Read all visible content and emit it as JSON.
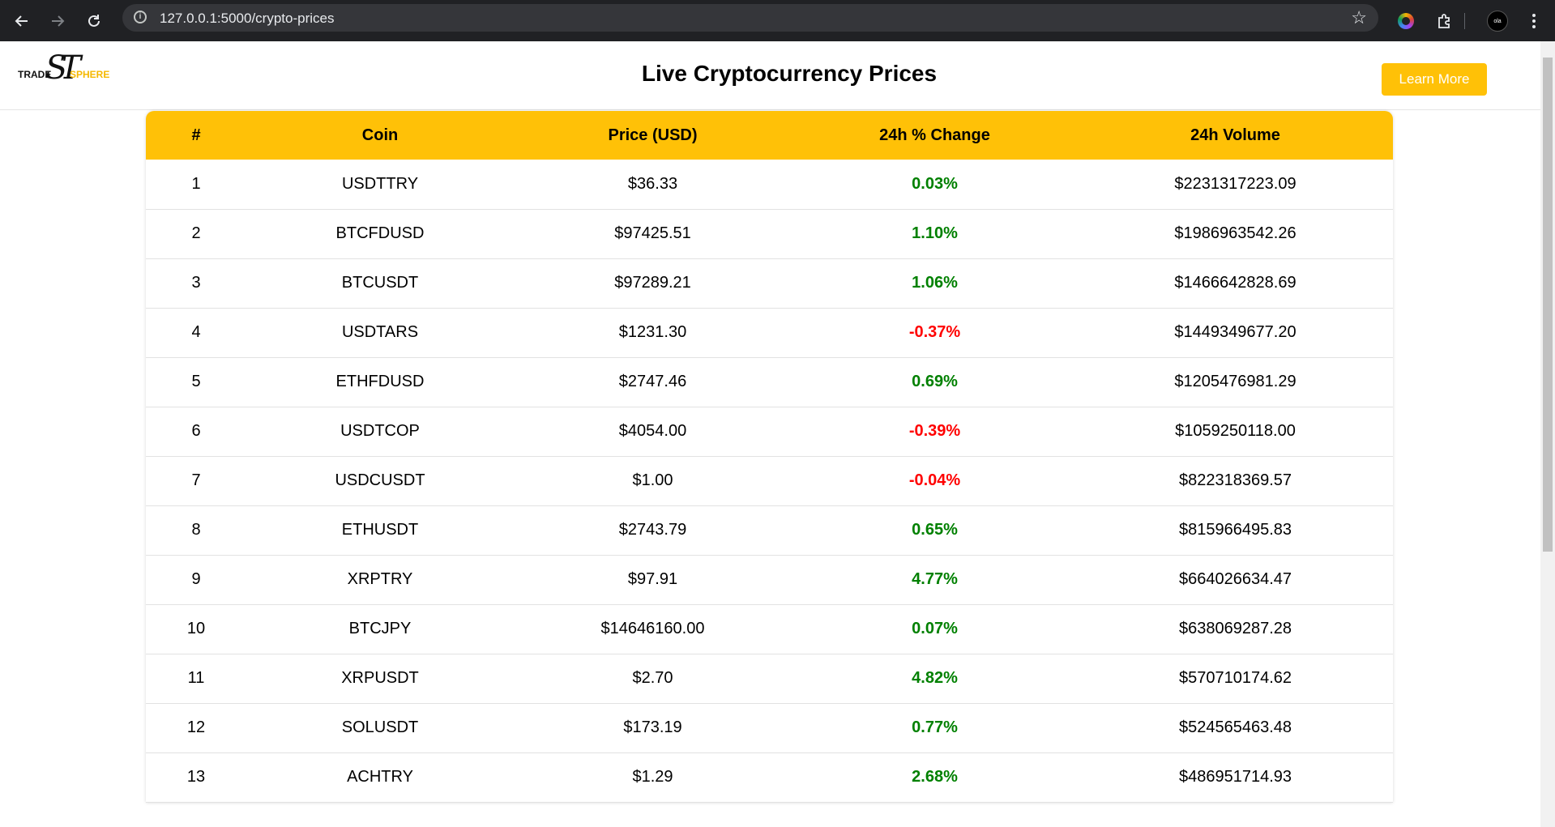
{
  "browser": {
    "url": "127.0.0.1:5000/crypto-prices",
    "back_icon": "arrow-left",
    "forward_icon": "arrow-right",
    "reload_icon": "reload",
    "avatar_text": "ola"
  },
  "header": {
    "logo_trade": "TRADE",
    "logo_sphere": "SPHERE",
    "logo_monogram": "ST",
    "title": "Live Cryptocurrency Prices",
    "learn_more": "Learn More"
  },
  "colors": {
    "accent": "#ffc107",
    "positive": "#008000",
    "negative": "#ff0000"
  },
  "table": {
    "columns": [
      "#",
      "Coin",
      "Price (USD)",
      "24h % Change",
      "24h Volume"
    ],
    "rows": [
      {
        "rank": "1",
        "coin": "USDTTRY",
        "price": "$36.33",
        "change": "0.03%",
        "direction": "up",
        "volume": "$2231317223.09"
      },
      {
        "rank": "2",
        "coin": "BTCFDUSD",
        "price": "$97425.51",
        "change": "1.10%",
        "direction": "up",
        "volume": "$1986963542.26"
      },
      {
        "rank": "3",
        "coin": "BTCUSDT",
        "price": "$97289.21",
        "change": "1.06%",
        "direction": "up",
        "volume": "$1466642828.69"
      },
      {
        "rank": "4",
        "coin": "USDTARS",
        "price": "$1231.30",
        "change": "-0.37%",
        "direction": "down",
        "volume": "$1449349677.20"
      },
      {
        "rank": "5",
        "coin": "ETHFDUSD",
        "price": "$2747.46",
        "change": "0.69%",
        "direction": "up",
        "volume": "$1205476981.29"
      },
      {
        "rank": "6",
        "coin": "USDTCOP",
        "price": "$4054.00",
        "change": "-0.39%",
        "direction": "down",
        "volume": "$1059250118.00"
      },
      {
        "rank": "7",
        "coin": "USDCUSDT",
        "price": "$1.00",
        "change": "-0.04%",
        "direction": "down",
        "volume": "$822318369.57"
      },
      {
        "rank": "8",
        "coin": "ETHUSDT",
        "price": "$2743.79",
        "change": "0.65%",
        "direction": "up",
        "volume": "$815966495.83"
      },
      {
        "rank": "9",
        "coin": "XRPTRY",
        "price": "$97.91",
        "change": "4.77%",
        "direction": "up",
        "volume": "$664026634.47"
      },
      {
        "rank": "10",
        "coin": "BTCJPY",
        "price": "$14646160.00",
        "change": "0.07%",
        "direction": "up",
        "volume": "$638069287.28"
      },
      {
        "rank": "11",
        "coin": "XRPUSDT",
        "price": "$2.70",
        "change": "4.82%",
        "direction": "up",
        "volume": "$570710174.62"
      },
      {
        "rank": "12",
        "coin": "SOLUSDT",
        "price": "$173.19",
        "change": "0.77%",
        "direction": "up",
        "volume": "$524565463.48"
      },
      {
        "rank": "13",
        "coin": "ACHTRY",
        "price": "$1.29",
        "change": "2.68%",
        "direction": "up",
        "volume": "$486951714.93"
      }
    ]
  }
}
